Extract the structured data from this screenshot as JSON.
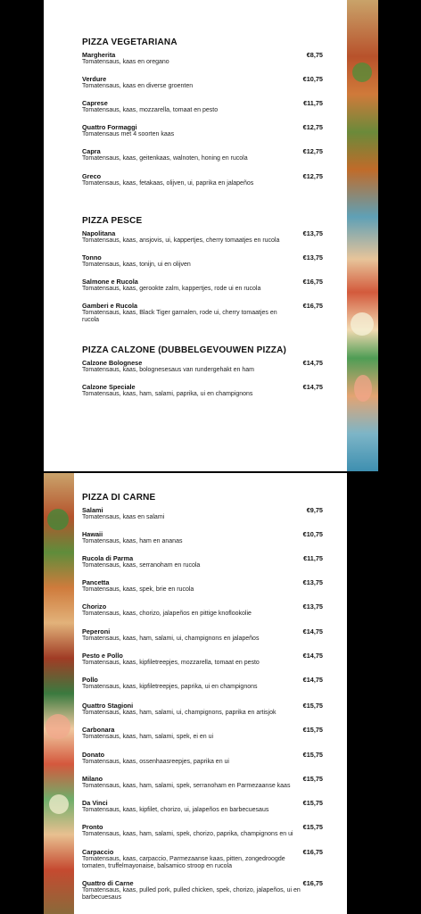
{
  "sections": [
    {
      "title": "PIZZA VEGETARIANA",
      "items": [
        {
          "name": "Margherita",
          "desc": "Tomatensaus, kaas en oregano",
          "price": "€8,75"
        },
        {
          "name": "Verdure",
          "desc": "Tomatensaus, kaas en diverse groenten",
          "price": "€10,75"
        },
        {
          "name": "Caprese",
          "desc": "Tomatensaus, kaas, mozzarella, tomaat en pesto",
          "price": "€11,75"
        },
        {
          "name": "Quattro Formaggi",
          "desc": "Tomatensaus met 4 soorten kaas",
          "price": "€12,75"
        },
        {
          "name": "Capra",
          "desc": "Tomatensaus, kaas, geitenkaas, walnoten, honing en rucola",
          "price": "€12,75"
        },
        {
          "name": "Greco",
          "desc": "Tomatensaus, kaas, fetakaas, olijven, ui, paprika en jalapeños",
          "price": "€12,75"
        }
      ]
    },
    {
      "title": "PIZZA PESCE",
      "items": [
        {
          "name": "Napolitana",
          "desc": "Tomatensaus, kaas, ansjovis, ui, kappertjes, cherry tomaatjes en rucola",
          "price": "€13,75"
        },
        {
          "name": "Tonno",
          "desc": "Tomatensaus, kaas, tonijn, ui en olijven",
          "price": "€13,75"
        },
        {
          "name": "Salmone e Rucola",
          "desc": "Tomatensaus, kaas, gerookte zalm, kappertjes, rode ui en rucola",
          "price": "€16,75"
        },
        {
          "name": "Gamberi e Rucola",
          "desc": "Tomatensaus, kaas, Black Tiger garnalen, rode ui, cherry tomaatjes en rucola",
          "price": "€16,75"
        }
      ]
    },
    {
      "title": "PIZZA CALZONE (DUBBELGEVOUWEN PIZZA)",
      "items": [
        {
          "name": "Calzone Bolognese",
          "desc": "Tomatensaus, kaas, bolognesesaus van rundergehakt en ham",
          "price": "€14,75"
        },
        {
          "name": "Calzone Speciale",
          "desc": "Tomatensaus, kaas, ham, salami, paprika, ui en champignons",
          "price": "€14,75"
        }
      ]
    },
    {
      "title": "PIZZA DI CARNE",
      "items": [
        {
          "name": "Salami",
          "desc": "Tomatensaus, kaas en salami",
          "price": "€9,75"
        },
        {
          "name": "Hawaii",
          "desc": "Tomatensaus, kaas, ham en ananas",
          "price": "€10,75"
        },
        {
          "name": "Rucola di Parma",
          "desc": "Tomatensaus, kaas, serranoham en rucola",
          "price": "€11,75"
        },
        {
          "name": "Pancetta",
          "desc": "Tomatensaus, kaas, spek, brie en rucola",
          "price": "€13,75"
        },
        {
          "name": "Chorizo",
          "desc": "Tomatensaus, kaas, chorizo, jalapeños en pittige knoflookolie",
          "price": "€13,75"
        },
        {
          "name": "Peperoni",
          "desc": "Tomatensaus, kaas, ham, salami, ui, champignons en jalapeños",
          "price": "€14,75"
        },
        {
          "name": "Pesto e Pollo",
          "desc": "Tomatensaus, kaas, kipfiletreepjes, mozzarella, tomaat en pesto",
          "price": "€14,75"
        },
        {
          "name": "Pollo",
          "desc": "Tomatensaus, kaas, kipfiletreepjes, paprika, ui en champignons",
          "price": "€14,75"
        },
        {
          "name": "Quattro Stagioni",
          "desc": "Tomatensaus, kaas, ham, salami, ui, champignons, paprika en artisjok",
          "price": "€15,75"
        },
        {
          "name": "Carbonara",
          "desc": "Tomatensaus, kaas, ham, salami, spek, ei en ui",
          "price": "€15,75"
        },
        {
          "name": "Donato",
          "desc": "Tomatensaus, kaas, ossenhaasreepjes, paprika en ui",
          "price": "€15,75"
        },
        {
          "name": "Milano",
          "desc": "Tomatensaus, kaas, ham, salami, spek, serranoham en Parmezaanse kaas",
          "price": "€15,75"
        },
        {
          "name": "Da Vinci",
          "desc": "Tomatensaus, kaas, kipfilet, chorizo, ui, jalapeños en barbecuesaus",
          "price": "€15,75"
        },
        {
          "name": "Pronto",
          "desc": "Tomatensaus, kaas, ham, salami, spek, chorizo, paprika, champignons en ui",
          "price": "€15,75"
        },
        {
          "name": "Carpaccio",
          "desc": "Tomatensaus, kaas, carpaccio, Parmezaanse kaas, pitten, zongedroogde tomaten, truffelmayonaise, balsamico stroop en rucola",
          "price": "€16,75"
        },
        {
          "name": "Quattro di Carne",
          "desc": "Tomatensaus, kaas, pulled pork, pulled chicken, spek, chorizo, jalapeños, ui en barbecuesaus",
          "price": "€16,75"
        }
      ]
    }
  ]
}
